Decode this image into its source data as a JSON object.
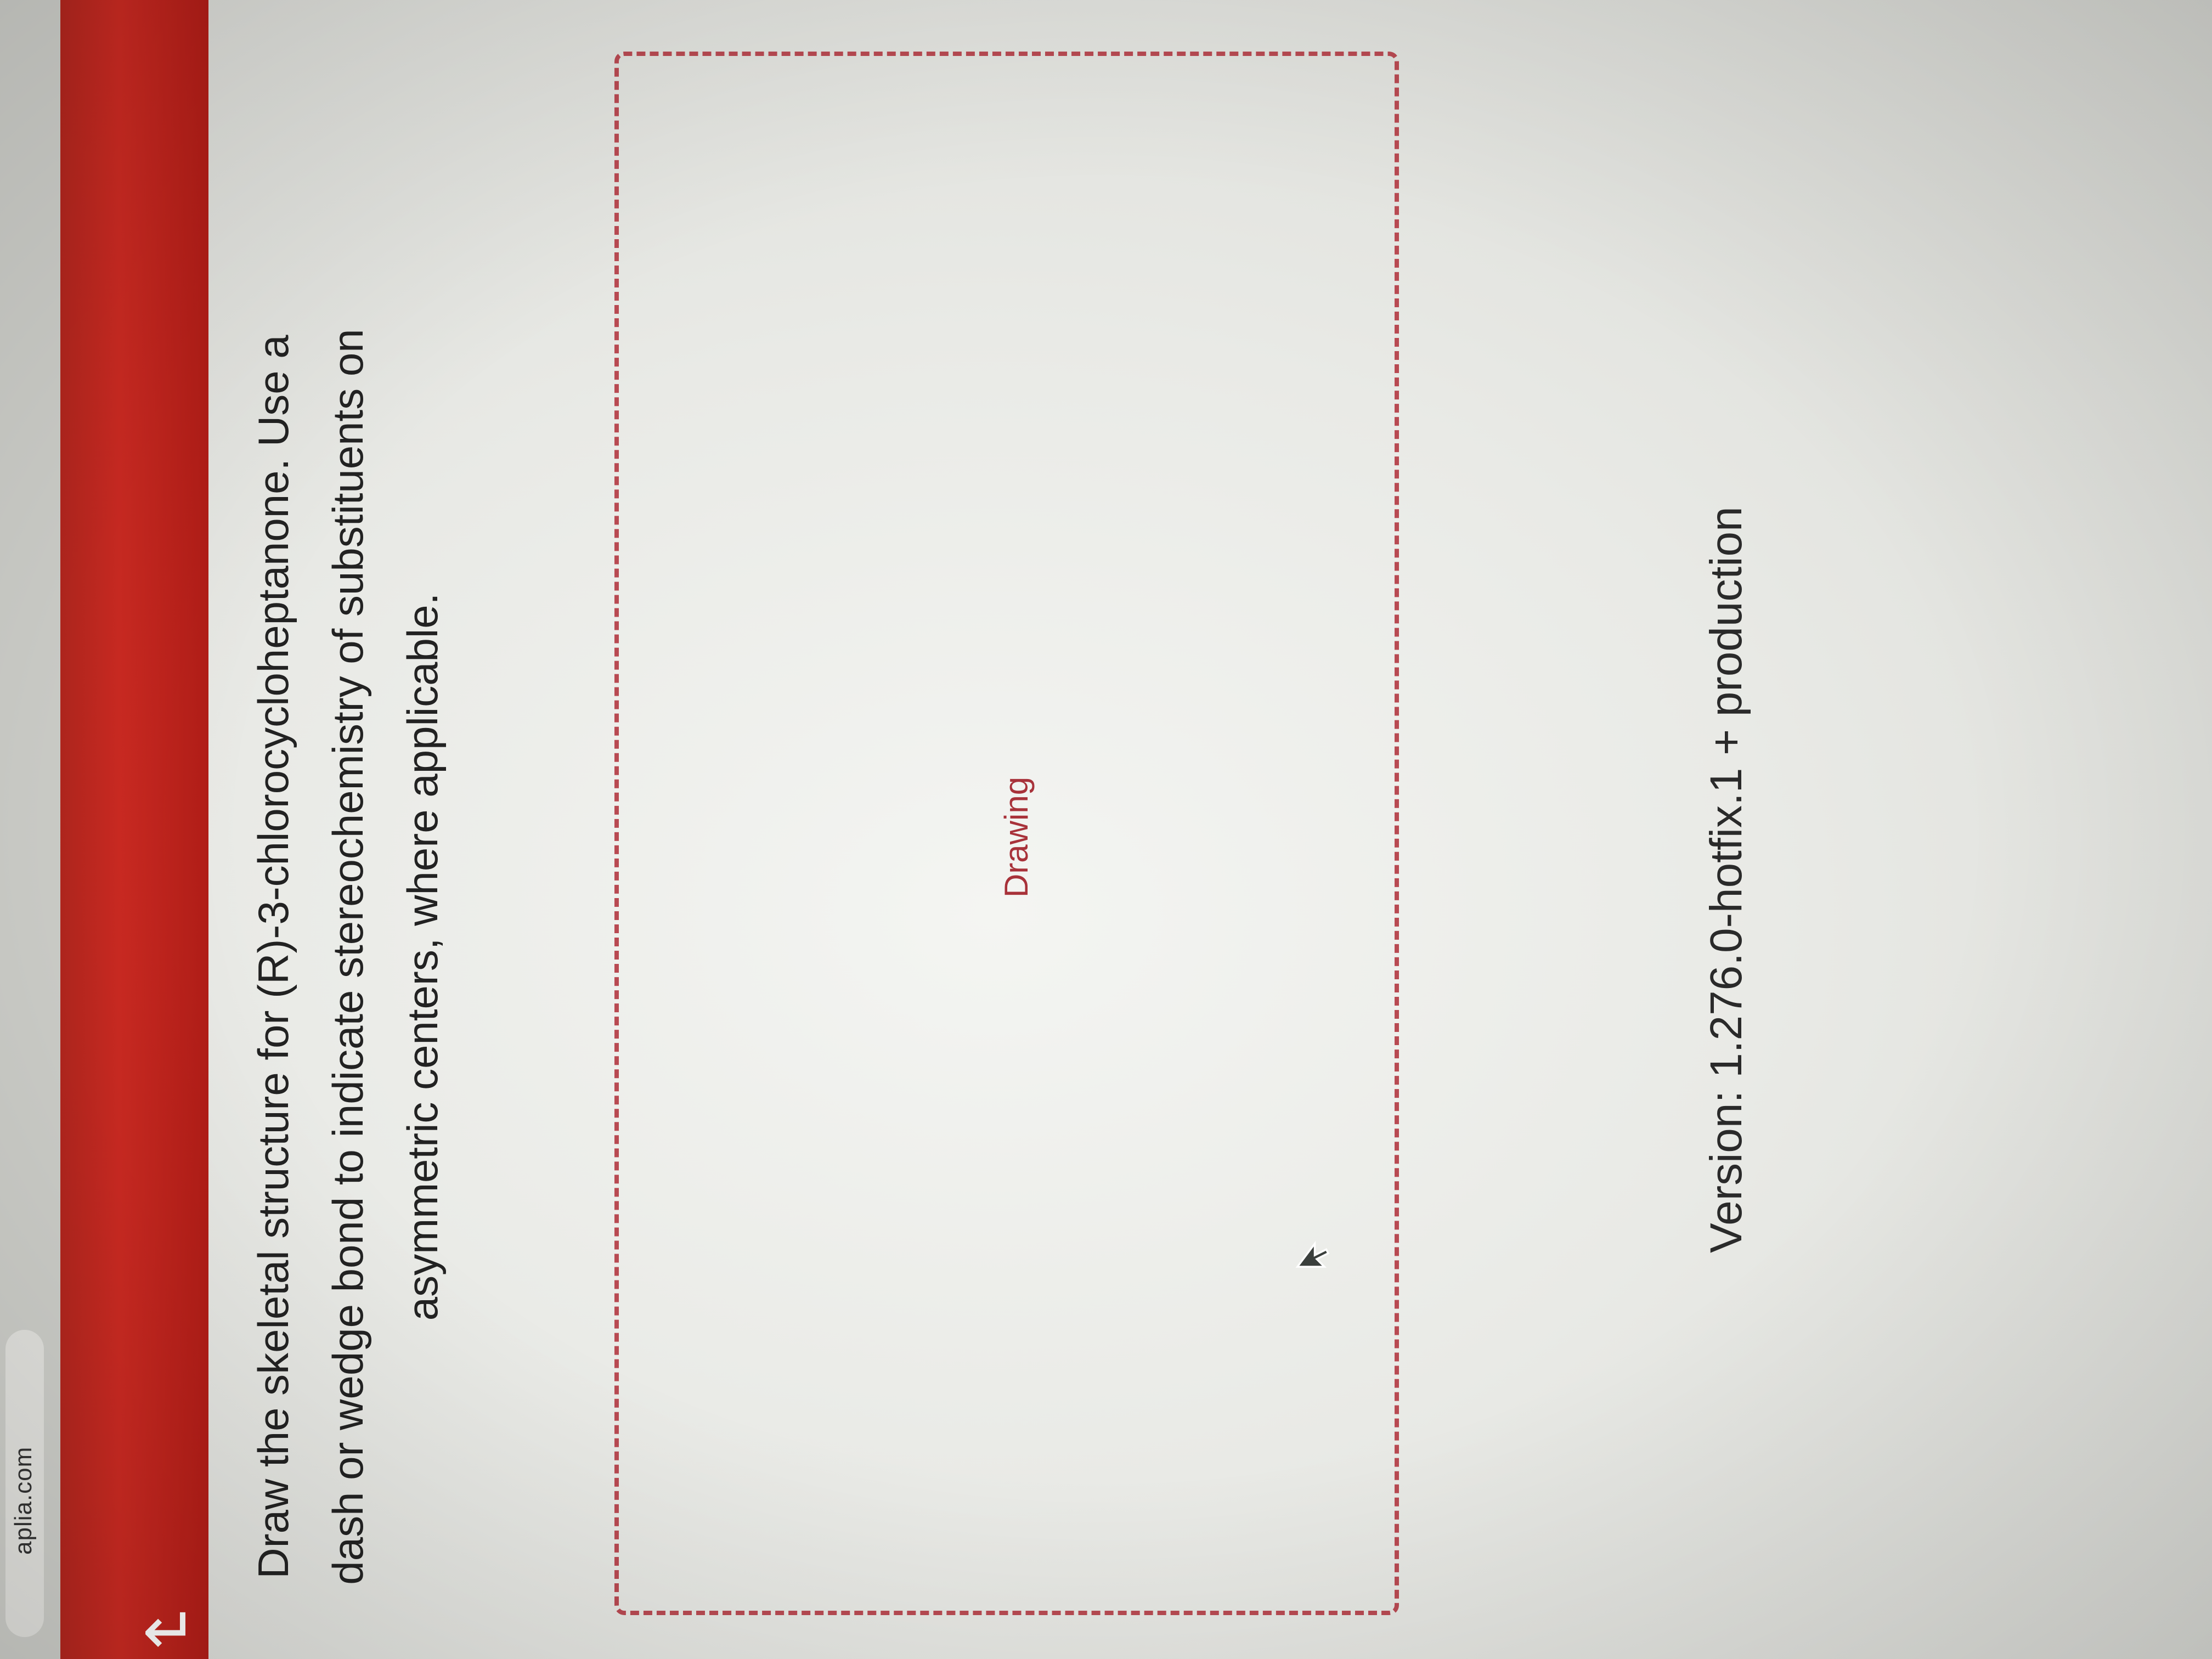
{
  "browser": {
    "tab_text": "aplia.com"
  },
  "header": {
    "back_icon": "back-arrow-icon",
    "accent_color": "#c4271f"
  },
  "question": {
    "line1": "Draw the skeletal structure for (R)-3-chlorocycloheptanone.  Use a",
    "line2": "dash or wedge bond to indicate stereochemistry of substituents on",
    "line3": "asymmetric centers, where applicable."
  },
  "drawing_area": {
    "label": "Drawing",
    "border_color": "#b84a52"
  },
  "footer": {
    "version": "Version: 1.276.0-hotfix.1 + production"
  }
}
